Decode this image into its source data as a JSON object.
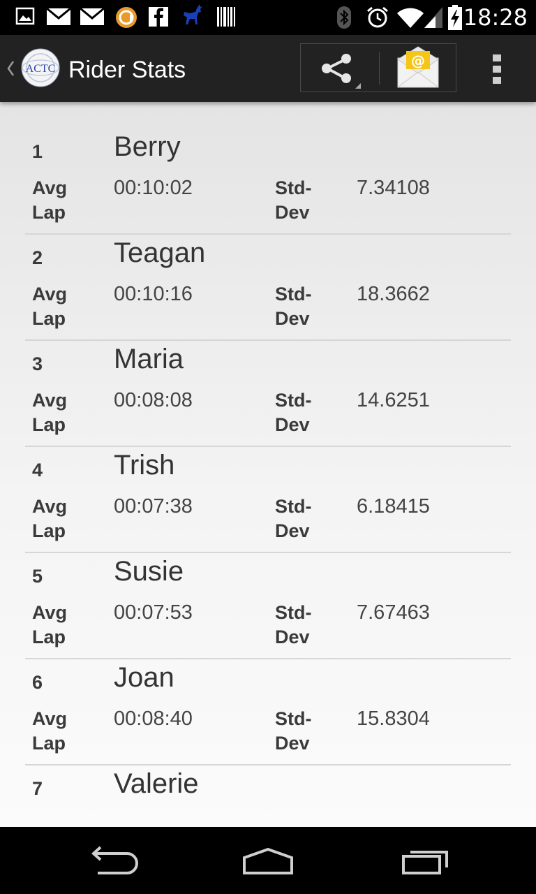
{
  "status_bar": {
    "time": "18:28",
    "icons": [
      "image-icon",
      "gmail-icon",
      "gmail-icon",
      "circle-app-icon",
      "facebook-icon",
      "deer-icon",
      "barcode-icon",
      "bluetooth-icon",
      "alarm-icon",
      "wifi-icon",
      "signal-icon",
      "battery-charging-icon"
    ]
  },
  "action_bar": {
    "title": "Rider Stats",
    "logo_text": "ACTC",
    "actions": [
      "share-icon",
      "email-icon",
      "overflow-menu-icon"
    ]
  },
  "riders": [
    {
      "rank": "1",
      "name": "Berry",
      "avg_label_1": "Avg",
      "avg_label_2": "Lap",
      "avg_lap": "00:10:02",
      "sd_label_1": "Std-",
      "sd_label_2": "Dev",
      "std_dev": "7.34108"
    },
    {
      "rank": "2",
      "name": "Teagan",
      "avg_label_1": "Avg",
      "avg_label_2": "Lap",
      "avg_lap": "00:10:16",
      "sd_label_1": "Std-",
      "sd_label_2": "Dev",
      "std_dev": "18.3662"
    },
    {
      "rank": "3",
      "name": "Maria",
      "avg_label_1": "Avg",
      "avg_label_2": "Lap",
      "avg_lap": "00:08:08",
      "sd_label_1": "Std-",
      "sd_label_2": "Dev",
      "std_dev": "14.6251"
    },
    {
      "rank": "4",
      "name": "Trish",
      "avg_label_1": "Avg",
      "avg_label_2": "Lap",
      "avg_lap": "00:07:38",
      "sd_label_1": "Std-",
      "sd_label_2": "Dev",
      "std_dev": "6.18415"
    },
    {
      "rank": "5",
      "name": "Susie",
      "avg_label_1": "Avg",
      "avg_label_2": "Lap",
      "avg_lap": "00:07:53",
      "sd_label_1": "Std-",
      "sd_label_2": "Dev",
      "std_dev": "7.67463"
    },
    {
      "rank": "6",
      "name": "Joan",
      "avg_label_1": "Avg",
      "avg_label_2": "Lap",
      "avg_lap": "00:08:40",
      "sd_label_1": "Std-",
      "sd_label_2": "Dev",
      "std_dev": "15.8304"
    },
    {
      "rank": "7",
      "name": "Valerie"
    }
  ],
  "nav_bar": {
    "buttons": [
      "back-icon",
      "home-icon",
      "recent-apps-icon"
    ]
  },
  "colors": {
    "status_bar": "#000000",
    "action_bar": "#222222",
    "content_background": "#ececec",
    "divider": "#d6d6d6",
    "email_accent": "#f5c518"
  }
}
